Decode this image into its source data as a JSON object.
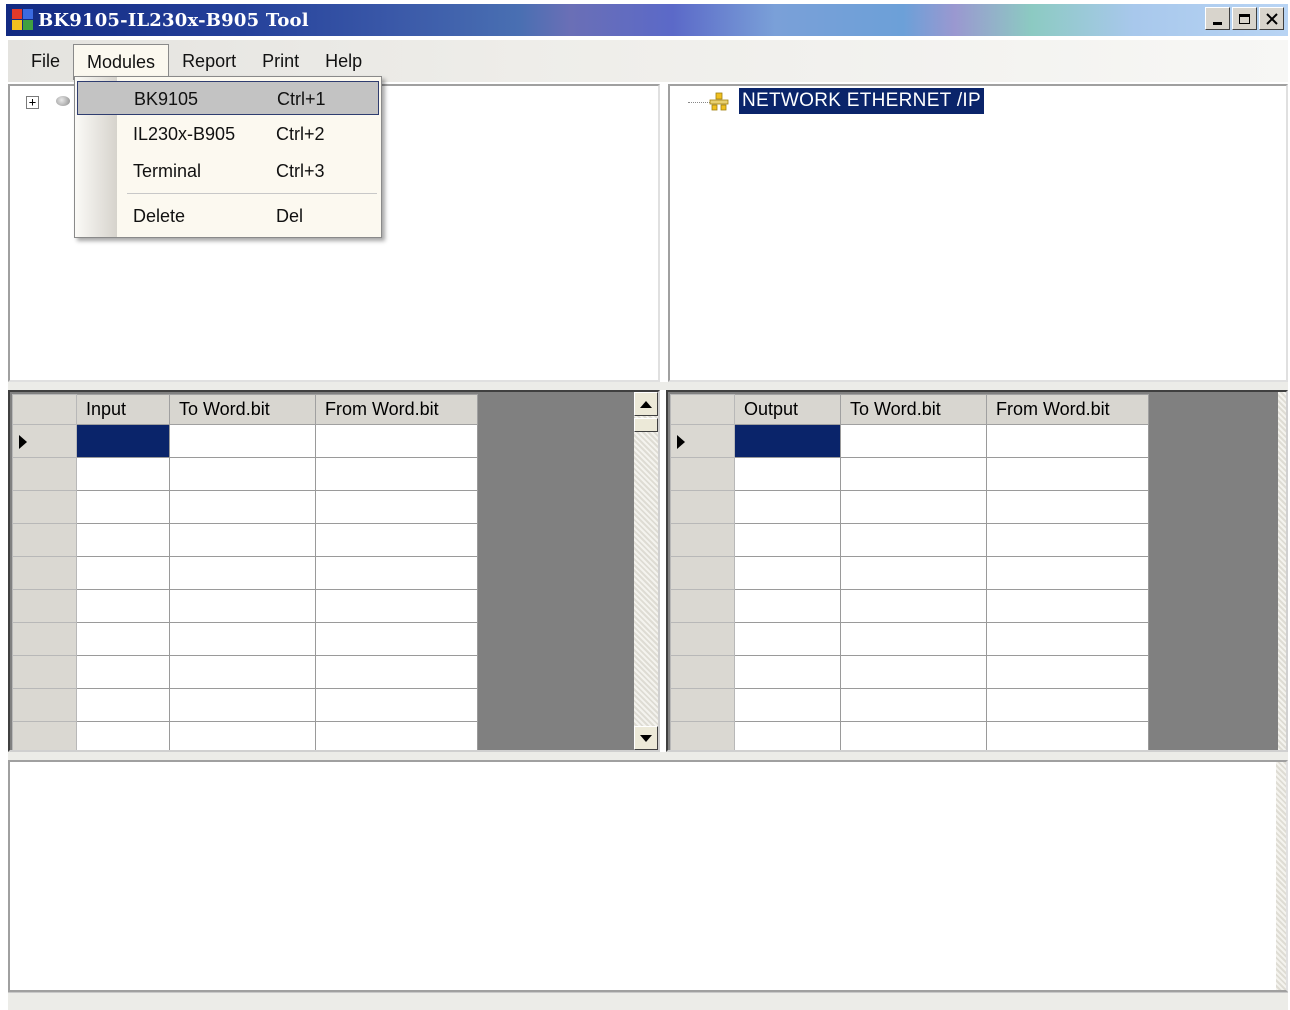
{
  "window": {
    "title": "BK9105-IL230x-B905 Tool"
  },
  "menubar": {
    "items": [
      {
        "label": "File"
      },
      {
        "label": "Modules"
      },
      {
        "label": "Report"
      },
      {
        "label": "Print"
      },
      {
        "label": "Help"
      }
    ]
  },
  "modules_menu": {
    "items": [
      {
        "label": "BK9105",
        "shortcut": "Ctrl+1"
      },
      {
        "label": "IL230x-B905",
        "shortcut": "Ctrl+2"
      },
      {
        "label": "Terminal",
        "shortcut": "Ctrl+3"
      },
      {
        "label": "Delete",
        "shortcut": "Del"
      }
    ]
  },
  "network_tree": {
    "root_label": "NETWORK ETHERNET /IP"
  },
  "input_grid": {
    "columns": [
      "Input",
      "To Word.bit",
      "From Word.bit"
    ]
  },
  "output_grid": {
    "columns": [
      "Output",
      "To Word.bit",
      "From Word.bit"
    ]
  },
  "colors": {
    "selection": "#0a246a",
    "grid_background": "#808080",
    "menu_background": "#fcf9f0"
  }
}
